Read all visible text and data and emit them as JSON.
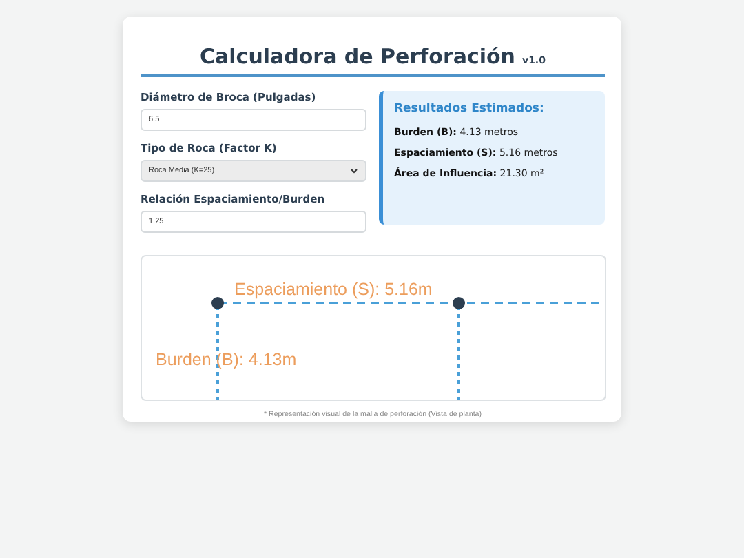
{
  "title": "Calculadora de Perforación",
  "version": "v1.0",
  "fields": [
    {
      "label": "Diámetro de Broca (Pulgadas)",
      "kind": "input",
      "value": "6.5"
    },
    {
      "label": "Tipo de Roca (Factor K)",
      "kind": "select",
      "value": "Roca Media (K=25)"
    },
    {
      "label": "Relación Espaciamiento/Burden",
      "kind": "input",
      "value": "1.25"
    }
  ],
  "results": {
    "title": "Resultados Estimados:",
    "items": [
      {
        "label": "Burden (B):",
        "value": "4.13 metros"
      },
      {
        "label": "Espaciamiento (S):",
        "value": "5.16 metros"
      },
      {
        "label": "Área de Influencia:",
        "value": "21.30 m²"
      }
    ]
  },
  "diagram": {
    "spacing_label": "Espaciamiento (S): 5.16m",
    "burden_label": "Burden (B): 4.13m"
  },
  "caption": "* Representación visual de la malla de perforación (Vista de planta)"
}
